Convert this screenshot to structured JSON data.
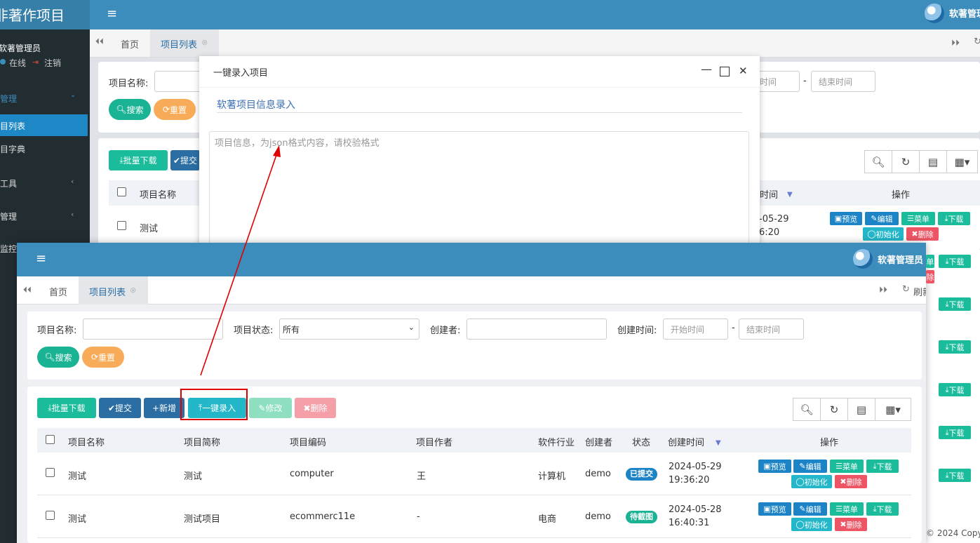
{
  "bg": {
    "app_title": "非著作项目",
    "brand": "软著管理员",
    "user_name": "软著管理员",
    "status_online": "在线",
    "logout": "注销",
    "menu": [
      {
        "label": "管理"
      },
      {
        "label": "目列表"
      },
      {
        "label": "目字典"
      },
      {
        "label": "工具"
      },
      {
        "label": "管理"
      },
      {
        "label": "监控"
      }
    ],
    "tab_home": "首页",
    "tab_list": "项目列表",
    "search_label": "项目名称:",
    "btn_search": "搜索",
    "btn_reset": "重置",
    "start_time_ph": "时间",
    "end_time_ph": "结束时间",
    "btn_batch": "批量下载",
    "btn_submit": "提交",
    "col_name": "项目名称",
    "col_time": "时间",
    "col_ops": "操作",
    "row_name": "测试",
    "row_date": "-05-29",
    "row_time": "6:20",
    "op_preview": "预览",
    "op_edit": "编辑",
    "op_menu": "菜单",
    "op_download": "下载",
    "op_init": "初始化",
    "op_delete": "删除",
    "op_partial_a": "单",
    "op_partial_b": "除",
    "copyright": "© 2024 Copyr"
  },
  "modal": {
    "title": "一键录入项目",
    "section_title": "软著项目信息录入",
    "textarea_placeholder": "项目信息，为json格式内容，请校验格式"
  },
  "fg": {
    "brand": "软著管理员",
    "tab_home": "首页",
    "tab_list": "项目列表",
    "refresh": "刷新",
    "filters": {
      "name_label": "项目名称:",
      "status_label": "项目状态:",
      "status_value": "所有",
      "creator_label": "创建者:",
      "time_label": "创建时间:",
      "start_ph": "开始时间",
      "end_ph": "结束时间",
      "search": "搜索",
      "reset": "重置"
    },
    "toolbar": {
      "batch": "批量下载",
      "submit": "提交",
      "add": "新增",
      "quick": "一键录入",
      "modify": "修改",
      "delete": "删除"
    },
    "columns": [
      "项目名称",
      "项目简称",
      "项目编码",
      "项目作者",
      "软件行业",
      "创建者",
      "状态",
      "创建时间",
      "操作"
    ],
    "rows": [
      {
        "name": "测试",
        "short": "测试",
        "code": "computer",
        "author": "王",
        "industry": "计算机",
        "creator": "demo",
        "status": "已提交",
        "date": "2024-05-29",
        "time": "19:36:20"
      },
      {
        "name": "测试",
        "short": "测试项目",
        "code": "ecommerc11e",
        "author": "-",
        "industry": "电商",
        "creator": "demo",
        "status": "待截图",
        "date": "2024-05-28",
        "time": "16:40:31"
      }
    ],
    "ops": {
      "preview": "预览",
      "edit": "编辑",
      "menu": "菜单",
      "download": "下载",
      "init": "初始化",
      "delete": "删除"
    }
  },
  "colors": {
    "header": "#3c8dbc",
    "sidebar": "#222d32",
    "accent_red": "#e00000"
  }
}
